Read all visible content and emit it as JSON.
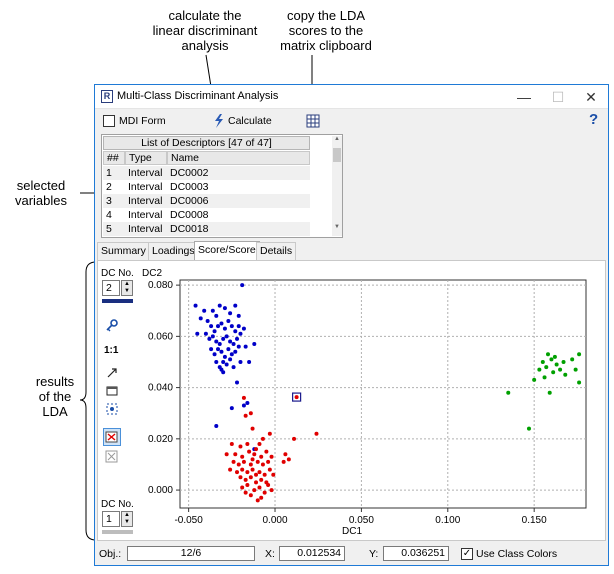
{
  "annotations": {
    "calculate": [
      "calculate the",
      "linear discriminant",
      "analysis"
    ],
    "copy": [
      "copy the LDA",
      "scores to the",
      "matrix clipboard"
    ],
    "selected": [
      "selected",
      "variables"
    ],
    "results": [
      "results",
      "of the",
      "LDA"
    ]
  },
  "window": {
    "title": "Multi-Class Discriminant Analysis",
    "icon_letter": "R",
    "minimize": "—",
    "maximize": "☐",
    "close": "✕"
  },
  "toolbar": {
    "mdi_label": "MDI Form",
    "mdi_checked": false,
    "calculate_label": "Calculate",
    "calculate_icon": "lightning-icon",
    "clipboard_icon": "matrix-clipboard-icon",
    "help": "?"
  },
  "descriptors": {
    "header": "List of Descriptors [47 of 47]",
    "columns": [
      "##",
      "Type",
      "Name"
    ],
    "rows": [
      {
        "num": "1",
        "type": "Interval",
        "name": "DC0002"
      },
      {
        "num": "2",
        "type": "Interval",
        "name": "DC0003"
      },
      {
        "num": "3",
        "type": "Interval",
        "name": "DC0006"
      },
      {
        "num": "4",
        "type": "Interval",
        "name": "DC0008"
      },
      {
        "num": "5",
        "type": "Interval",
        "name": "DC0018"
      }
    ]
  },
  "tabs": [
    {
      "label": "Summary",
      "active": false
    },
    {
      "label": "Loadings",
      "active": false
    },
    {
      "label": "Score/Score",
      "active": true
    },
    {
      "label": "Details",
      "active": false
    }
  ],
  "side": {
    "dc_label_y": "DC No.",
    "dc_value_y": "2",
    "scale_label": "1:1",
    "dc_label_x": "DC No.",
    "dc_value_x": "1",
    "tool_icons": [
      "key-icon",
      "expand-arrow-icon",
      "copy-window-icon",
      "target-icon",
      "class-colors-icon",
      "clear-icon"
    ]
  },
  "status": {
    "obj_label": "Obj.:",
    "obj_value": "12/6",
    "x_label": "X:",
    "x_value": "0.012534",
    "y_label": "Y:",
    "y_value": "0.036251",
    "class_colors_label": "Use Class Colors",
    "class_colors_checked": true
  },
  "chart_data": {
    "type": "scatter",
    "xlabel": "DC1",
    "ylabel": "DC2",
    "xlim": [
      -0.055,
      0.18
    ],
    "ylim": [
      -0.007,
      0.082
    ],
    "xticks": [
      "-0.050",
      "0.000",
      "0.050",
      "0.100",
      "0.150"
    ],
    "yticks": [
      "0.000",
      "0.020",
      "0.040",
      "0.060",
      "0.080"
    ],
    "xtick_values": [
      -0.05,
      0.0,
      0.05,
      0.1,
      0.15
    ],
    "ytick_values": [
      0.0,
      0.02,
      0.04,
      0.06,
      0.08
    ],
    "grid": true,
    "selected_point": [
      0.0125,
      0.0363
    ],
    "series": [
      {
        "color": "#0000c8",
        "points": [
          [
            -0.046,
            0.072
          ],
          [
            -0.041,
            0.07
          ],
          [
            -0.043,
            0.067
          ],
          [
            -0.039,
            0.066
          ],
          [
            -0.036,
            0.07
          ],
          [
            -0.034,
            0.068
          ],
          [
            -0.032,
            0.072
          ],
          [
            -0.029,
            0.071
          ],
          [
            -0.026,
            0.069
          ],
          [
            -0.023,
            0.072
          ],
          [
            -0.021,
            0.068
          ],
          [
            -0.019,
            0.08
          ],
          [
            -0.037,
            0.064
          ],
          [
            -0.035,
            0.062
          ],
          [
            -0.033,
            0.064
          ],
          [
            -0.031,
            0.065
          ],
          [
            -0.029,
            0.063
          ],
          [
            -0.027,
            0.066
          ],
          [
            -0.025,
            0.064
          ],
          [
            -0.023,
            0.062
          ],
          [
            -0.021,
            0.064
          ],
          [
            -0.04,
            0.061
          ],
          [
            -0.038,
            0.059
          ],
          [
            -0.036,
            0.06
          ],
          [
            -0.034,
            0.058
          ],
          [
            -0.032,
            0.057
          ],
          [
            -0.03,
            0.059
          ],
          [
            -0.028,
            0.06
          ],
          [
            -0.026,
            0.058
          ],
          [
            -0.024,
            0.057
          ],
          [
            -0.022,
            0.059
          ],
          [
            -0.02,
            0.061
          ],
          [
            -0.018,
            0.063
          ],
          [
            -0.045,
            0.061
          ],
          [
            -0.037,
            0.055
          ],
          [
            -0.035,
            0.053
          ],
          [
            -0.033,
            0.055
          ],
          [
            -0.031,
            0.054
          ],
          [
            -0.029,
            0.052
          ],
          [
            -0.027,
            0.055
          ],
          [
            -0.025,
            0.053
          ],
          [
            -0.023,
            0.054
          ],
          [
            -0.021,
            0.056
          ],
          [
            -0.017,
            0.056
          ],
          [
            -0.012,
            0.057
          ],
          [
            -0.034,
            0.05
          ],
          [
            -0.032,
            0.048
          ],
          [
            -0.03,
            0.05
          ],
          [
            -0.028,
            0.049
          ],
          [
            -0.026,
            0.051
          ],
          [
            -0.024,
            0.048
          ],
          [
            -0.02,
            0.05
          ],
          [
            -0.015,
            0.05
          ],
          [
            -0.03,
            0.046
          ],
          [
            -0.022,
            0.042
          ],
          [
            -0.018,
            0.033
          ],
          [
            -0.025,
            0.032
          ],
          [
            -0.034,
            0.025
          ],
          [
            -0.012,
            0.016
          ],
          [
            -0.016,
            0.034
          ],
          [
            -0.031,
            0.047
          ]
        ]
      },
      {
        "color": "#e00000",
        "points": [
          [
            -0.018,
            0.036
          ],
          [
            -0.014,
            0.03
          ],
          [
            -0.017,
            0.029
          ],
          [
            -0.013,
            0.024
          ],
          [
            -0.009,
            0.018
          ],
          [
            -0.007,
            0.02
          ],
          [
            -0.003,
            0.022
          ],
          [
            -0.025,
            0.018
          ],
          [
            -0.02,
            0.017
          ],
          [
            -0.016,
            0.018
          ],
          [
            -0.011,
            0.016
          ],
          [
            -0.028,
            0.014
          ],
          [
            -0.023,
            0.014
          ],
          [
            -0.019,
            0.013
          ],
          [
            -0.015,
            0.015
          ],
          [
            -0.012,
            0.014
          ],
          [
            -0.008,
            0.013
          ],
          [
            -0.005,
            0.015
          ],
          [
            -0.024,
            0.011
          ],
          [
            -0.021,
            0.01
          ],
          [
            -0.018,
            0.011
          ],
          [
            -0.014,
            0.01
          ],
          [
            -0.01,
            0.011
          ],
          [
            -0.007,
            0.01
          ],
          [
            -0.004,
            0.011
          ],
          [
            -0.002,
            0.013
          ],
          [
            -0.026,
            0.008
          ],
          [
            -0.022,
            0.007
          ],
          [
            -0.019,
            0.008
          ],
          [
            -0.016,
            0.007
          ],
          [
            -0.013,
            0.008
          ],
          [
            -0.009,
            0.007
          ],
          [
            -0.006,
            0.006
          ],
          [
            -0.003,
            0.008
          ],
          [
            -0.02,
            0.005
          ],
          [
            -0.017,
            0.004
          ],
          [
            -0.014,
            0.005
          ],
          [
            -0.011,
            0.003
          ],
          [
            -0.008,
            0.004
          ],
          [
            -0.005,
            0.003
          ],
          [
            -0.019,
            0.001
          ],
          [
            -0.016,
            0.002
          ],
          [
            -0.012,
            0.0
          ],
          [
            -0.009,
            0.001
          ],
          [
            -0.006,
            -0.001
          ],
          [
            -0.002,
            0.0
          ],
          [
            -0.014,
            -0.002
          ],
          [
            -0.008,
            -0.003
          ],
          [
            -0.017,
            -0.001
          ],
          [
            -0.004,
            0.002
          ],
          [
            0.006,
            0.014
          ],
          [
            0.011,
            0.02
          ],
          [
            0.024,
            0.022
          ],
          [
            0.005,
            0.011
          ],
          [
            -0.01,
            -0.004
          ],
          [
            -0.013,
            0.012
          ],
          [
            -0.001,
            0.006
          ],
          [
            0.008,
            0.012
          ],
          [
            -0.011,
            0.006
          ]
        ]
      },
      {
        "color": "#00a000",
        "points": [
          [
            0.135,
            0.038
          ],
          [
            0.147,
            0.024
          ],
          [
            0.15,
            0.043
          ],
          [
            0.153,
            0.047
          ],
          [
            0.155,
            0.05
          ],
          [
            0.156,
            0.044
          ],
          [
            0.157,
            0.048
          ],
          [
            0.158,
            0.053
          ],
          [
            0.159,
            0.038
          ],
          [
            0.16,
            0.051
          ],
          [
            0.161,
            0.046
          ],
          [
            0.162,
            0.052
          ],
          [
            0.163,
            0.049
          ],
          [
            0.165,
            0.047
          ],
          [
            0.167,
            0.05
          ],
          [
            0.168,
            0.045
          ],
          [
            0.172,
            0.051
          ],
          [
            0.174,
            0.047
          ],
          [
            0.176,
            0.042
          ],
          [
            0.176,
            0.053
          ]
        ]
      }
    ]
  }
}
